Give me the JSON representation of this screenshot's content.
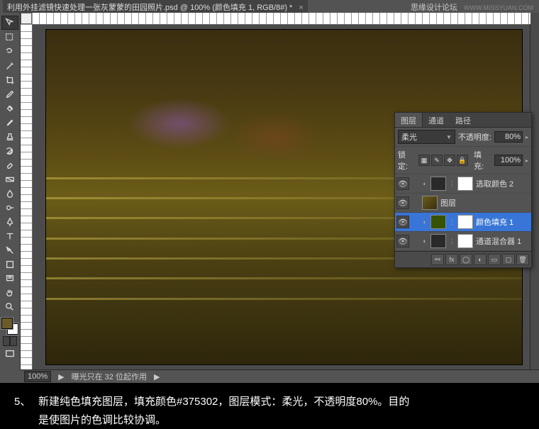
{
  "titlebar": {
    "tab_title": "利用外挂滤镜快速处理一张灰蒙蒙的田园照片.psd @ 100% (颜色填充 1, RGB/8#) *",
    "brand": "思缘设计论坛",
    "brand_url": "WWW.MISSYUAN.COM"
  },
  "status": {
    "zoom": "100%",
    "hint": "曝光只在 32 位起作用"
  },
  "layers_panel": {
    "tabs": [
      "图层",
      "通道",
      "路径"
    ],
    "blend_mode": "柔光",
    "opacity_label": "不透明度:",
    "opacity_value": "80%",
    "lock_label": "锁定:",
    "fill_label": "填充:",
    "fill_value": "100%",
    "rows": [
      {
        "name": "选取颜色 2",
        "thumb": "dark",
        "mask": true,
        "adj": true
      },
      {
        "name": "图层",
        "thumb": "img",
        "mask": false,
        "adj": false
      },
      {
        "name": "颜色填充 1",
        "thumb": "olive",
        "mask": true,
        "adj": true,
        "selected": true
      },
      {
        "name": "通道混合器 1",
        "thumb": "dark",
        "mask": true,
        "adj": true
      }
    ]
  },
  "caption": {
    "index": "5、",
    "line1": "新建纯色填充图层，填充颜色#375302，图层模式：柔光，不透明度80%。目的",
    "line2": "是使图片的色调比较协调。"
  }
}
